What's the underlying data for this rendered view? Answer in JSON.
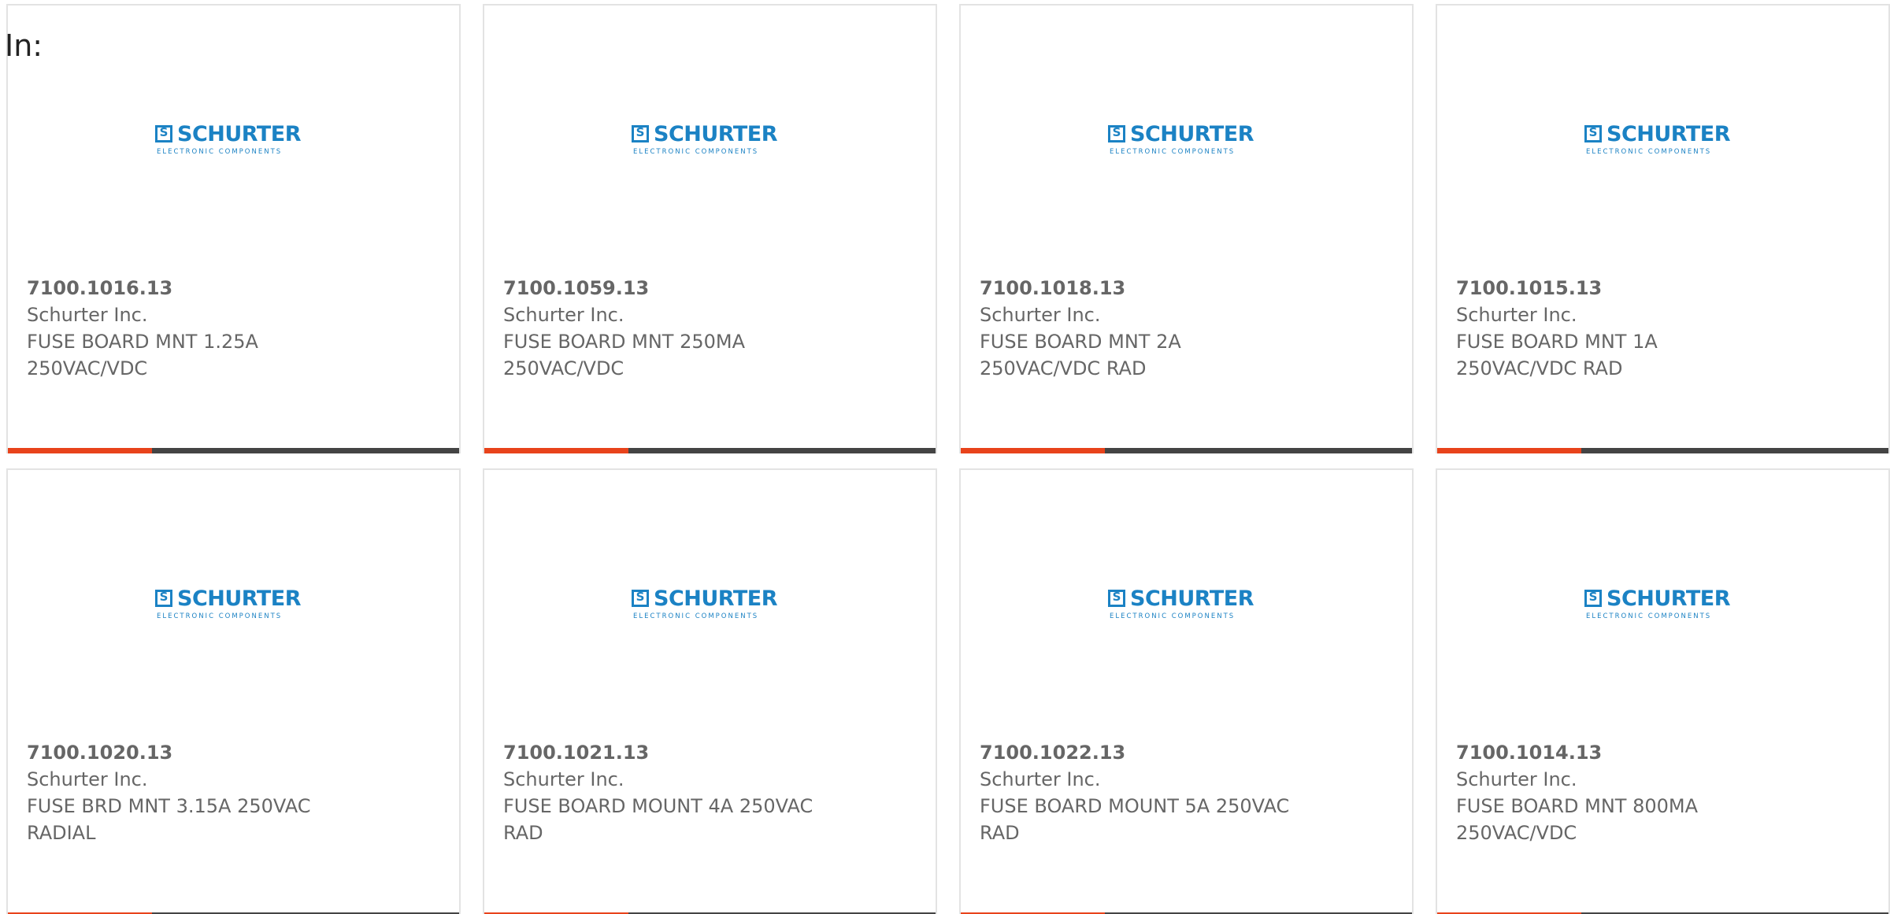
{
  "header": {
    "prefix": "In:"
  },
  "accent_color": "#e8431b",
  "bar_color": "#444444",
  "brand_color": "#1b82c4",
  "logo": {
    "mark": "S",
    "name": "SCHURTER",
    "tagline": "ELECTRONIC COMPONENTS"
  },
  "products": [
    {
      "part": "7100.1016.13",
      "maker": "Schurter Inc.",
      "desc1": "FUSE BOARD MNT 1.25A",
      "desc2": "250VAC/VDC"
    },
    {
      "part": "7100.1059.13",
      "maker": "Schurter Inc.",
      "desc1": "FUSE BOARD MNT 250MA",
      "desc2": "250VAC/VDC"
    },
    {
      "part": "7100.1018.13",
      "maker": "Schurter Inc.",
      "desc1": "FUSE BOARD MNT 2A",
      "desc2": "250VAC/VDC RAD"
    },
    {
      "part": "7100.1015.13",
      "maker": "Schurter Inc.",
      "desc1": "FUSE BOARD MNT 1A",
      "desc2": "250VAC/VDC RAD"
    },
    {
      "part": "7100.1020.13",
      "maker": "Schurter Inc.",
      "desc1": "FUSE BRD MNT 3.15A 250VAC",
      "desc2": "RADIAL"
    },
    {
      "part": "7100.1021.13",
      "maker": "Schurter Inc.",
      "desc1": "FUSE BOARD MOUNT 4A 250VAC",
      "desc2": "RAD"
    },
    {
      "part": "7100.1022.13",
      "maker": "Schurter Inc.",
      "desc1": "FUSE BOARD MOUNT 5A 250VAC",
      "desc2": "RAD"
    },
    {
      "part": "7100.1014.13",
      "maker": "Schurter Inc.",
      "desc1": "FUSE BOARD MNT 800MA",
      "desc2": "250VAC/VDC"
    }
  ]
}
